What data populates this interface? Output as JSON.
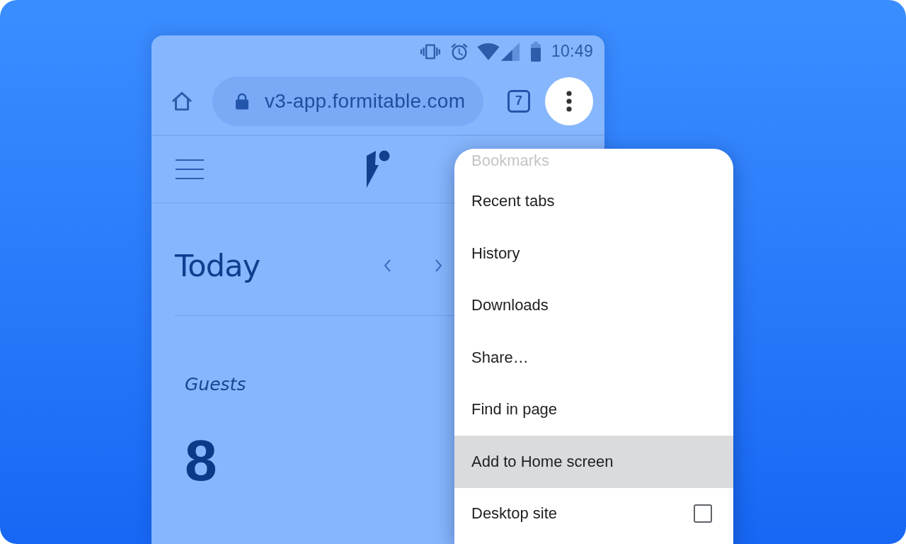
{
  "status_bar": {
    "time": "10:49"
  },
  "browser_toolbar": {
    "url": "v3-app.formitable.com",
    "tab_count": "7",
    "more_button": {
      "pressed": true
    }
  },
  "app": {
    "title": "Today",
    "guests_label": "Guests",
    "guests_count": "8"
  },
  "menu": {
    "faded_item": "Bookmarks",
    "items": [
      {
        "label": "Recent tabs",
        "kind": "plain",
        "selected": false
      },
      {
        "label": "History",
        "kind": "plain",
        "selected": false
      },
      {
        "label": "Downloads",
        "kind": "plain",
        "selected": false
      },
      {
        "label": "Share…",
        "kind": "plain",
        "selected": false
      },
      {
        "label": "Find in page",
        "kind": "plain",
        "selected": false
      },
      {
        "label": "Add to Home screen",
        "kind": "plain",
        "selected": true
      },
      {
        "label": "Desktop site",
        "kind": "checkbox",
        "selected": false,
        "checked": false
      }
    ]
  }
}
